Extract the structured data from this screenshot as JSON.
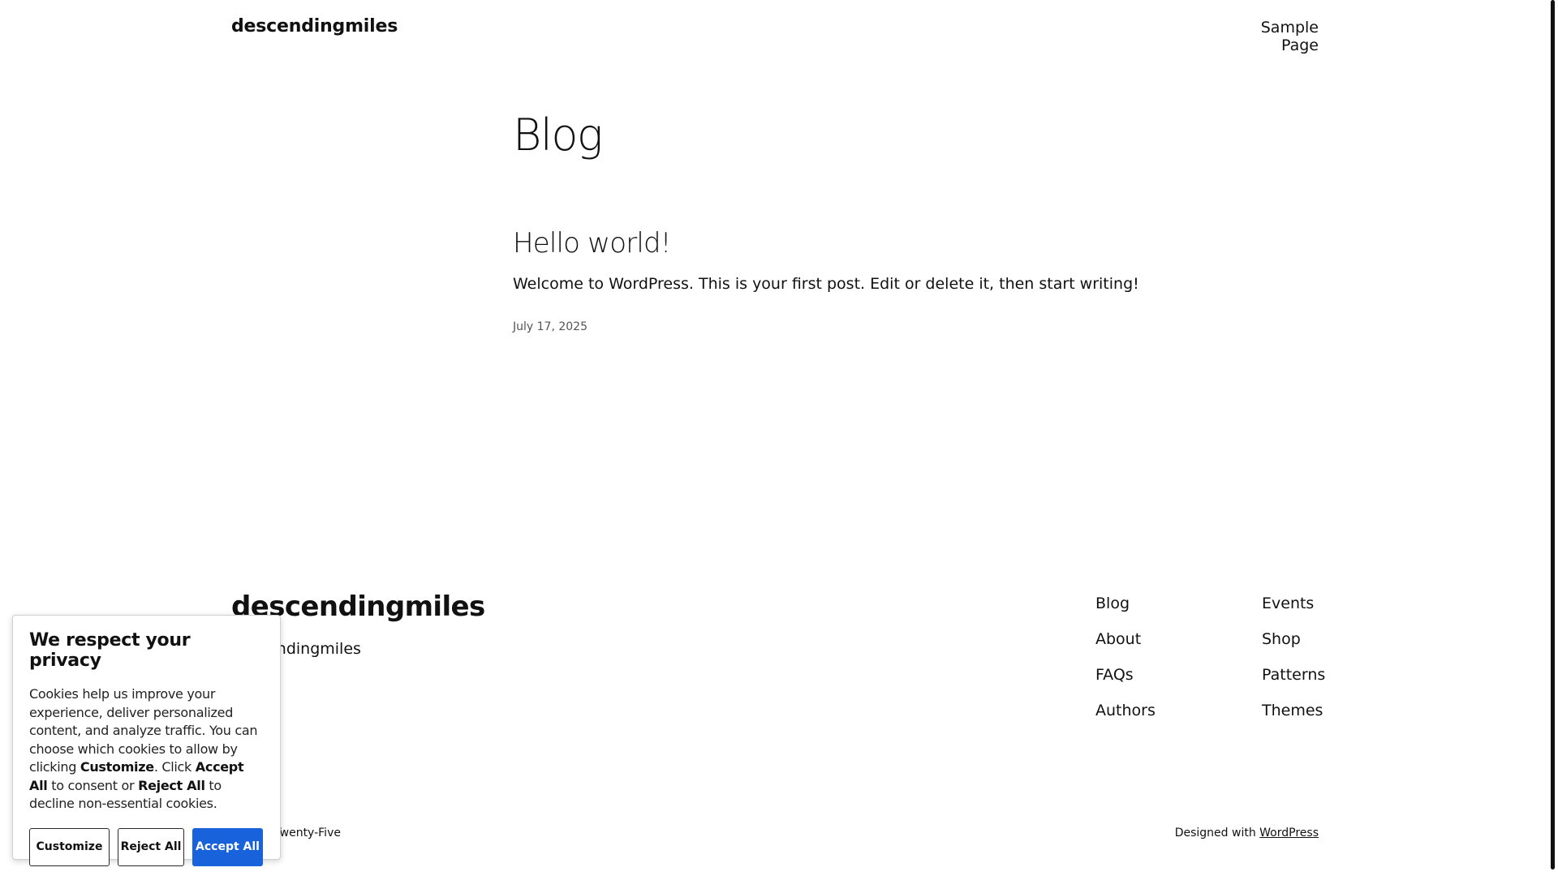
{
  "header": {
    "site_title": "descendingmiles",
    "nav": [
      "Sample Page"
    ]
  },
  "main": {
    "heading": "Blog",
    "posts": [
      {
        "title": "Hello world!",
        "excerpt": "Welcome to WordPress. This is your first post. Edit or delete it, then start writing!",
        "date": "July 17, 2025"
      }
    ]
  },
  "footer": {
    "site_title": "descendingmiles",
    "tagline": "descendingmiles",
    "nav_col1": [
      "Blog",
      "About",
      "FAQs",
      "Authors"
    ],
    "nav_col2": [
      "Events",
      "Shop",
      "Patterns",
      "Themes"
    ],
    "credit_left": "Twenty Twenty-Five",
    "credit_right_prefix": "Designed with ",
    "credit_right_link": "WordPress"
  },
  "cookie_banner": {
    "heading": "We respect your privacy",
    "text_part1": "Cookies help us improve your experience, deliver personalized content, and analyze traffic. You can choose which cookies to allow by clicking ",
    "text_bold1": "Customize",
    "text_part2": ". Click ",
    "text_bold2": "Accept All",
    "text_part3": " to consent or ",
    "text_bold3": "Reject All",
    "text_part4": " to decline non-essential cookies.",
    "buttons": {
      "customize": "Customize",
      "reject": "Reject All",
      "accept": "Accept All"
    },
    "accent_color": "#1863dc"
  }
}
